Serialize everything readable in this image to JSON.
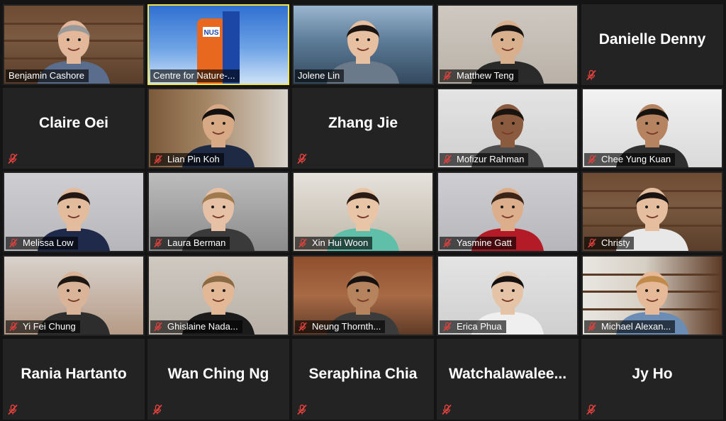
{
  "meeting": {
    "participants": [
      {
        "name": "Benjamin Cashore",
        "video": true,
        "muted": false,
        "active": false,
        "scene": "bookshelf",
        "skin": "#e2b79a",
        "hair": "#9a9a9a",
        "shirt": "#5a6d8c"
      },
      {
        "name": "Centre for Nature-based Climate Solutions",
        "display": "Centre for Nature-...",
        "video": true,
        "muted": false,
        "active": true,
        "scene": "sky",
        "skin": "#e85a1c",
        "hair": "#1f4ea8",
        "shirt": "#e85a1c"
      },
      {
        "name": "Jolene Lin",
        "video": true,
        "muted": false,
        "active": false,
        "scene": "city",
        "skin": "#e7c0a1",
        "hair": "#1b1410",
        "shirt": "#6b7a8a"
      },
      {
        "name": "Matthew Teng",
        "video": true,
        "muted": true,
        "active": false,
        "scene": "room",
        "skin": "#d9b08e",
        "hair": "#171311",
        "shirt": "#2a2a2a"
      },
      {
        "name": "Danielle Denny",
        "video": false,
        "muted": true
      },
      {
        "name": "Claire Oei",
        "video": false,
        "muted": true
      },
      {
        "name": "Lian Pin Koh",
        "video": true,
        "muted": true,
        "active": false,
        "scene": "wood",
        "skin": "#d8a985",
        "hair": "#141010",
        "shirt": "#1e2a44"
      },
      {
        "name": "Zhang Jie",
        "video": false,
        "muted": true
      },
      {
        "name": "Mofizur Rahman",
        "video": true,
        "muted": true,
        "active": false,
        "scene": "white",
        "skin": "#8a5b3e",
        "hair": "#1a1410",
        "shirt": "#4d4d4d"
      },
      {
        "name": "Chee Yung Kuan",
        "video": true,
        "muted": true,
        "active": false,
        "scene": "office",
        "skin": "#b58360",
        "hair": "#161210",
        "shirt": "#2f2f2f"
      },
      {
        "name": "Melissa Low",
        "video": true,
        "muted": true,
        "active": false,
        "scene": "plain",
        "skin": "#e3bc9e",
        "hair": "#231813",
        "shirt": "#1f2a4a"
      },
      {
        "name": "Laura Berman",
        "video": true,
        "muted": true,
        "active": false,
        "scene": "storage",
        "skin": "#e6c1a6",
        "hair": "#a07a4f",
        "shirt": "#3a3a3a"
      },
      {
        "name": "Xin Hui Woon",
        "video": true,
        "muted": true,
        "active": false,
        "scene": "bedroom",
        "skin": "#e9c5a8",
        "hair": "#2a1c15",
        "shirt": "#5fbfa8"
      },
      {
        "name": "Yasmine Gatt",
        "video": true,
        "muted": true,
        "active": false,
        "scene": "plain",
        "skin": "#dcae8c",
        "hair": "#3b2519",
        "shirt": "#b31b26"
      },
      {
        "name": "Christy",
        "video": true,
        "muted": true,
        "active": false,
        "scene": "bookshelf",
        "skin": "#e5bea0",
        "hair": "#191311",
        "shirt": "#e8e8e8"
      },
      {
        "name": "Yi Fei Chung",
        "video": true,
        "muted": true,
        "active": false,
        "scene": "shelf",
        "skin": "#d9b499",
        "hair": "#1d1714",
        "shirt": "#2d2d2d"
      },
      {
        "name": "Ghislaine Nadaud",
        "display": "Ghislaine Nada...",
        "video": true,
        "muted": true,
        "active": false,
        "scene": "room",
        "skin": "#e2b896",
        "hair": "#8a6a45",
        "shirt": "#1b1b1b"
      },
      {
        "name": "Neung Thornthep",
        "display": "Neung Thornth...",
        "video": true,
        "muted": true,
        "active": false,
        "scene": "curtain",
        "skin": "#b5835d",
        "hair": "#151111",
        "shirt": "#3b3b3b"
      },
      {
        "name": "Erica Phua",
        "video": true,
        "muted": true,
        "active": false,
        "scene": "white",
        "skin": "#e5c3a6",
        "hair": "#141010",
        "shirt": "#efefef"
      },
      {
        "name": "Michael Alexander",
        "display": "Michael Alexan...",
        "video": true,
        "muted": true,
        "active": false,
        "scene": "library",
        "skin": "#e6b999",
        "hair": "#c08a4a",
        "shirt": "#6a8cb5"
      },
      {
        "name": "Rania Hartanto",
        "video": false,
        "muted": true
      },
      {
        "name": "Wan Ching Ng",
        "video": false,
        "muted": true
      },
      {
        "name": "Seraphina Chia",
        "video": false,
        "muted": true
      },
      {
        "name": "Watchalawalee...",
        "video": false,
        "muted": true
      },
      {
        "name": "Jy Ho",
        "video": false,
        "muted": true
      }
    ]
  }
}
